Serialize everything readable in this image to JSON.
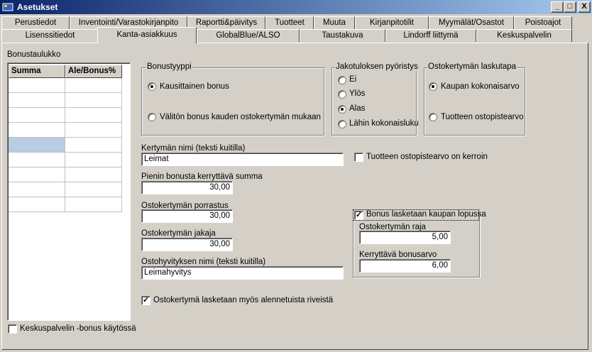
{
  "window": {
    "title": "Asetukset",
    "buttons": {
      "minimize": "_",
      "maximize": "□",
      "close": "X"
    }
  },
  "tabs_row1": [
    "Perustiedot",
    "Inventointi/Varastokirjanpito",
    "Raportti&päivitys",
    "Tuotteet",
    "Muuta",
    "Kirjanpitotilit",
    "Myymälät/Osastot",
    "Poistoajot"
  ],
  "tabs_row2": [
    "Lisenssitiedot",
    "Kanta-asiakkuus",
    "GlobalBlue/ALSO",
    "Taustakuva",
    "Lindorff liittymä",
    "Keskuspalvelin"
  ],
  "bonus_table": {
    "label": "Bonustaulukko",
    "col_summa": "Summa",
    "col_ale": "Ale/Bonus%"
  },
  "bonustyyppi": {
    "title": "Bonustyyppi",
    "opt1": "Kausittainen bonus",
    "opt2": "Välitön bonus kauden ostokertymän mukaan",
    "selected": "Kausittainen bonus"
  },
  "jakotulos": {
    "title": "Jakotuloksen pyöristys",
    "opt1": "Ei",
    "opt2": "Ylös",
    "opt3": "Alas",
    "opt4": "Lähin kokonaisluku",
    "selected": "Alas"
  },
  "laskutapa": {
    "title": "Ostokertymän laskutapa",
    "opt1": "Kaupan kokonaisarvo",
    "opt2": "Tuotteen ostopistearvo",
    "selected": "Kaupan kokonaisarvo"
  },
  "fields": {
    "kertyman_nimi_label": "Kertymän nimi (teksti kuitilla)",
    "kertyman_nimi": "Leimat",
    "pienin_label": "Pienin bonusta kerryttävä summa",
    "pienin": "30,00",
    "porrastus_label": "Ostokertymän porrastus",
    "porrastus": "30,00",
    "jakaja_label": "Ostokertymän jakaja",
    "jakaja": "30,00",
    "hyvitys_label": "Ostohyvityksen nimi (teksti kuitilla)",
    "hyvitys": "Leimahyvitys"
  },
  "kerroin": {
    "label": "Tuotteen ostopistearvo on kerroin",
    "checked": false
  },
  "lopussa": {
    "label": "Bonus lasketaan kaupan lopussa",
    "checked": true,
    "raja_label": "Ostokertymän raja",
    "raja": "5,00",
    "bonusarvo_label": "Kerryttävä bonusarvo",
    "bonusarvo": "6,00"
  },
  "alennetuista": {
    "label": "Ostokertymä lasketaan myös alennetuista riveistä",
    "checked": true
  },
  "keskuspalvelin": {
    "label": "Keskuspalvelin -bonus käytössä",
    "checked": false
  }
}
